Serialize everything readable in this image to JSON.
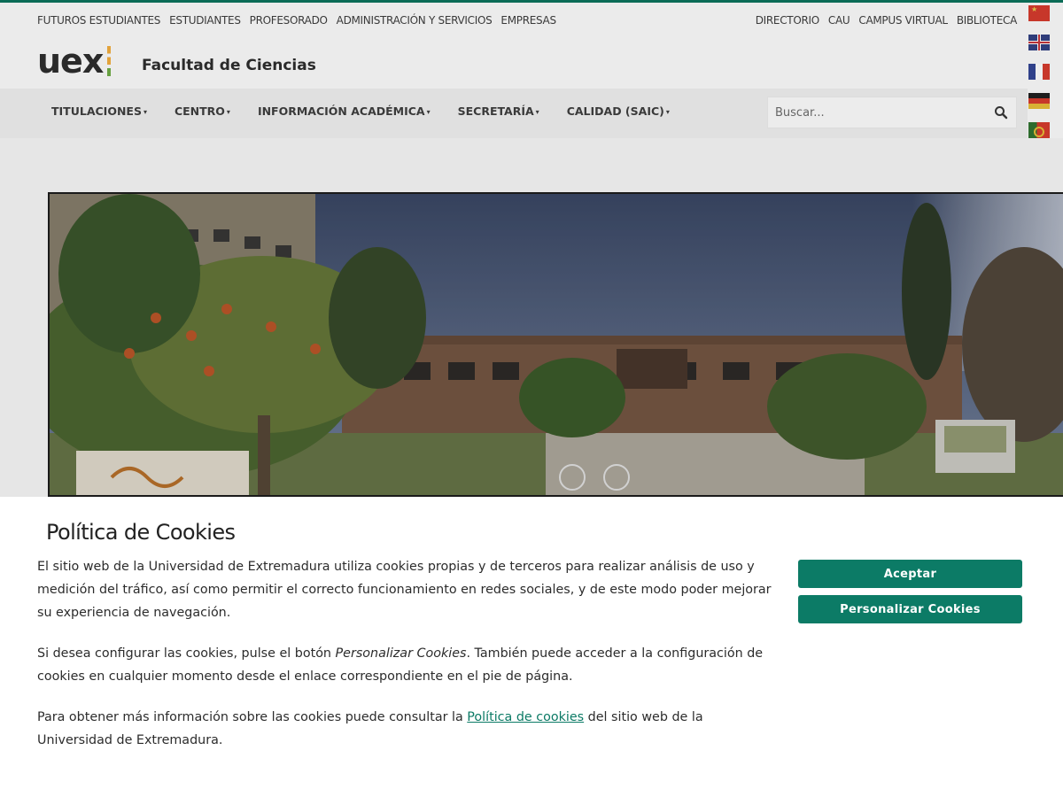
{
  "topbar": {
    "left_links": [
      "FUTUROS ESTUDIANTES",
      "ESTUDIANTES",
      "PROFESORADO",
      "ADMINISTRACIÓN Y SERVICIOS",
      "EMPRESAS"
    ],
    "right_links": [
      "DIRECTORIO",
      "CAU",
      "CAMPUS VIRTUAL",
      "BIBLIOTECA"
    ]
  },
  "languages": [
    "chinese-flag-icon",
    "uk-flag-icon",
    "france-flag-icon",
    "germany-flag-icon",
    "portugal-flag-icon"
  ],
  "brand": {
    "logo_text": "uex",
    "faculty_name": "Facultad de Ciencias"
  },
  "nav": {
    "items": [
      "TITULACIONES",
      "CENTRO",
      "INFORMACIÓN ACADÉMICA",
      "SECRETARÍA",
      "CALIDAD (SAIC)"
    ]
  },
  "search": {
    "placeholder": "Buscar...",
    "icon": "search-icon"
  },
  "cookie_banner": {
    "title": "Política de Cookies",
    "paragraph1": "El sitio web de la Universidad de Extremadura utiliza cookies propias y de terceros para realizar análisis de uso y medición del tráfico, así como permitir el correcto funcionamiento en redes sociales, y de este modo poder mejorar su experiencia de navegación.",
    "paragraph2_before": "Si desea configurar las cookies, pulse el botón ",
    "paragraph2_em": "Personalizar Cookies",
    "paragraph2_after": ". También puede acceder a la configuración de cookies en cualquier momento desde el enlace correspondiente en el pie de página.",
    "paragraph3_before": "Para obtener más información sobre las cookies puede consultar la ",
    "paragraph3_link": "Política de cookies",
    "paragraph3_after": " del sitio web de la Universidad de Extremadura.",
    "accept_label": "Aceptar",
    "customize_label": "Personalizar Cookies"
  },
  "colors": {
    "accent": "#0c7b66",
    "logo_orange": "#e2a23b",
    "logo_green": "#67a040"
  }
}
